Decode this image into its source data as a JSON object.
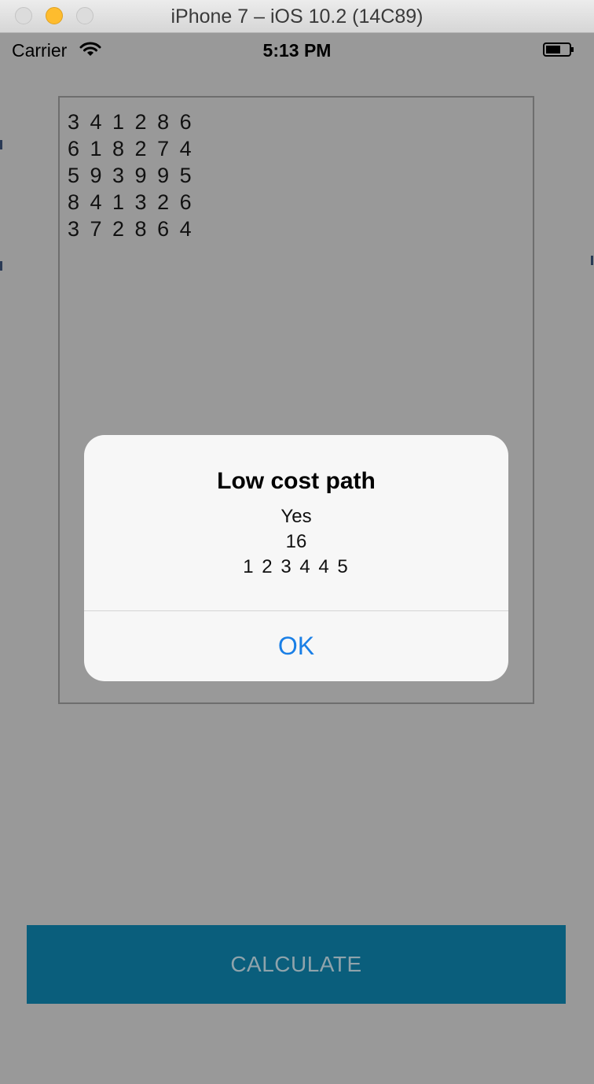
{
  "window": {
    "title": "iPhone 7 – iOS 10.2 (14C89)"
  },
  "status_bar": {
    "carrier": "Carrier",
    "time": "5:13 PM"
  },
  "matrix": {
    "lines": [
      "3 4 1 2 8 6",
      "6 1 8 2 7 4",
      "5 9 3 9 9 5",
      "8 4 1 3 2 6",
      "3 7 2 8 6 4"
    ]
  },
  "calculate_button": {
    "label": "CALCULATE",
    "color": "#0a5e7c"
  },
  "alert": {
    "title": "Low cost path",
    "message_lines": [
      "Yes",
      "16",
      "1 2 3 4 4 5"
    ],
    "ok_label": "OK",
    "ok_color": "#1a7fe6"
  }
}
